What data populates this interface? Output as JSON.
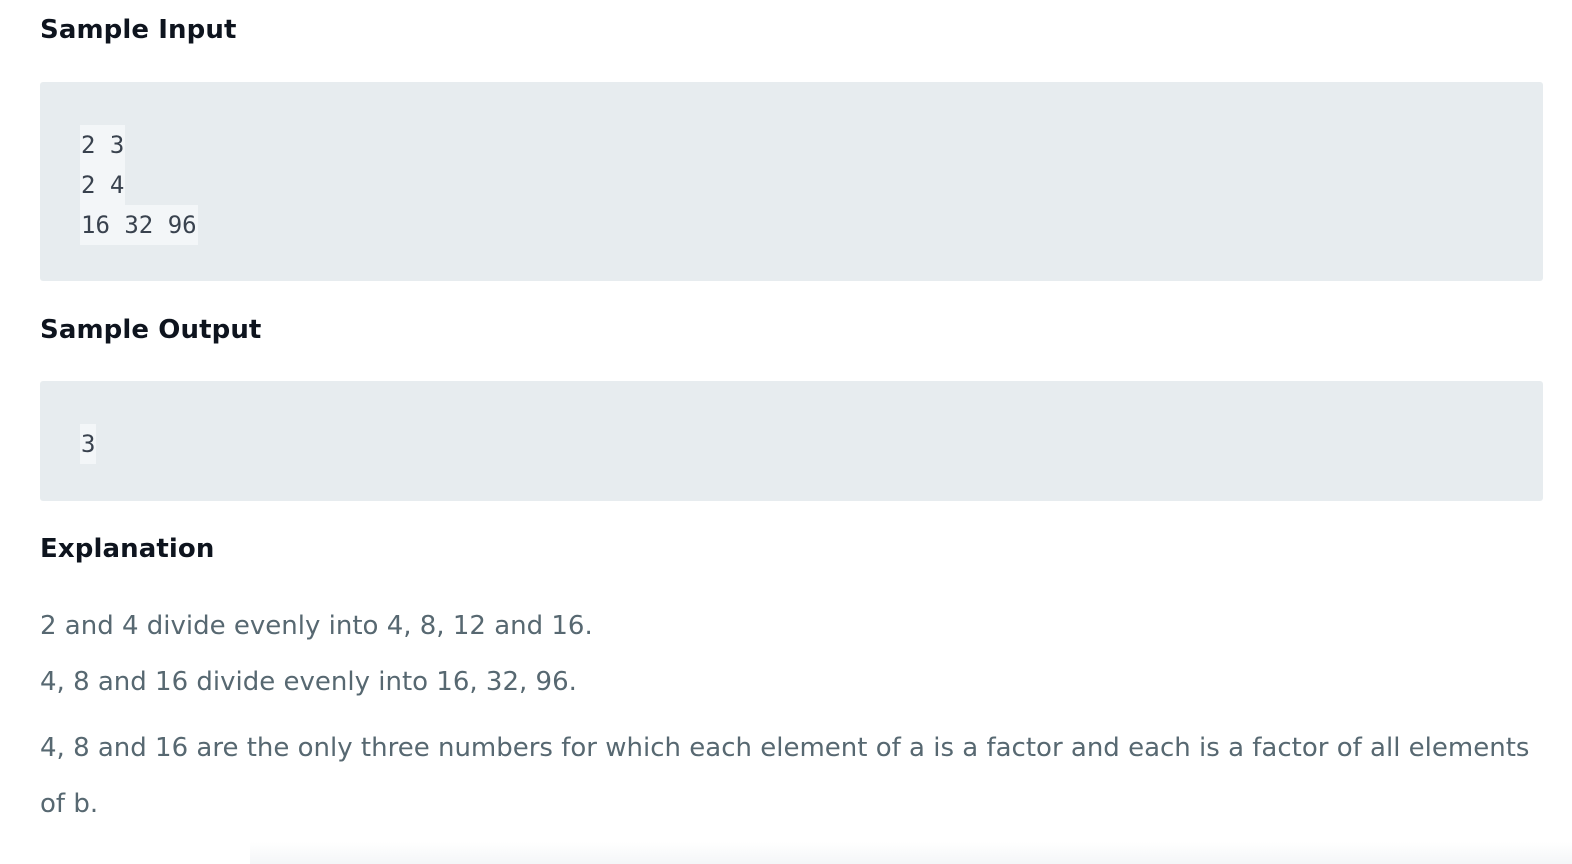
{
  "sample_input": {
    "heading": "Sample Input",
    "lines": [
      "2 3",
      "2 4",
      "16 32 96"
    ]
  },
  "sample_output": {
    "heading": "Sample Output",
    "lines": [
      "3"
    ]
  },
  "explanation": {
    "heading": "Explanation",
    "paragraphs": [
      "2 and 4 divide evenly into 4, 8, 12 and 16.",
      "4, 8 and 16 divide evenly into 16, 32, 96.",
      "4, 8 and 16 are the only three numbers for which each element of a is a factor and each is a factor of all elements of b."
    ]
  },
  "colors": {
    "heading": "#0e141e",
    "body_text": "#576871",
    "code_block_bg": "#e7ecef",
    "code_line_bg": "#f3f6f8",
    "code_text": "#39424e"
  }
}
